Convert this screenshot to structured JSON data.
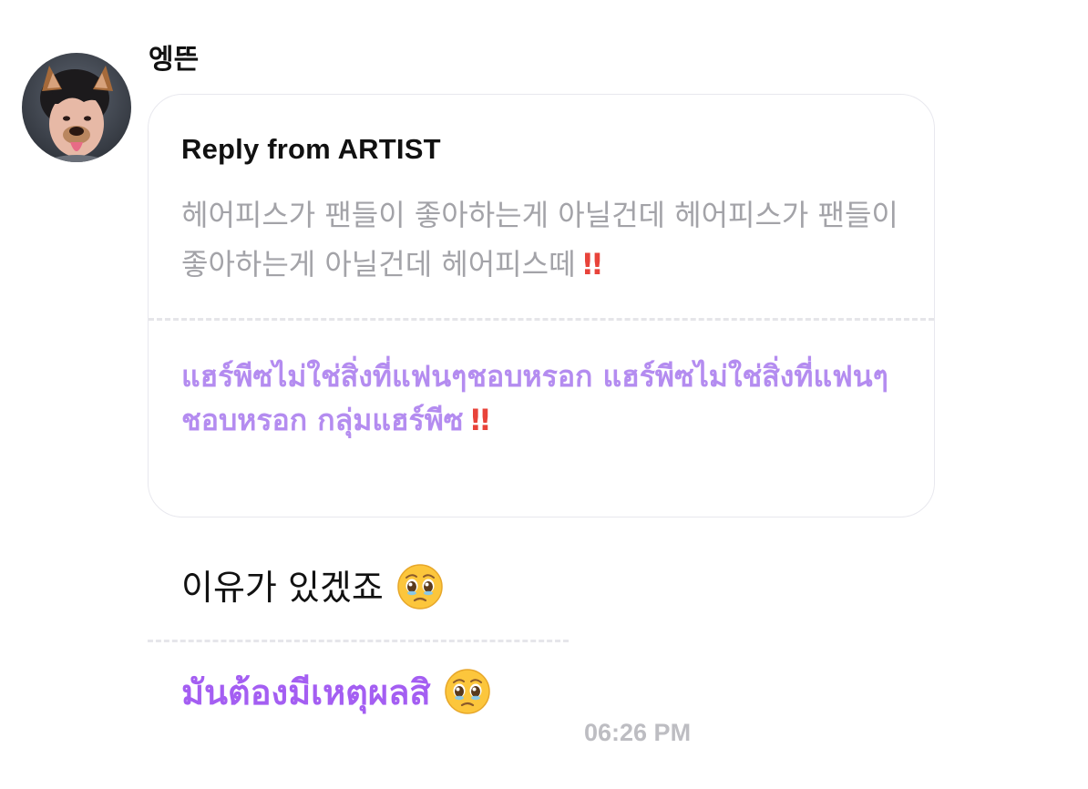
{
  "message": {
    "sender_name": "엥뜬",
    "reply_title": "Reply from ARTIST",
    "reply_original": "헤어피스가 팬들이 좋아하는게 아닐건데 헤어피스가 팬들이 좋아하는게 아닐건데 헤어피스떼",
    "reply_translation": "แฮร์พีซไม่ใช่สิ่งที่แฟนๆชอบหรอก แฮร์พีซไม่ใช่สิ่งที่แฟนๆชอบหรอก กลุ่มแฮร์พีซ",
    "reply_emphasis": "!!",
    "body_original": "이유가 있겠죠",
    "body_translation": "มันต้องมีเหตุผลสิ",
    "timestamp": "06:26 PM"
  },
  "icons": {
    "avatar": "profile-photo-dog-filter",
    "emphasis": "double-exclamation-icon",
    "emoji": "pleading-face-emoji-icon"
  },
  "colors": {
    "original_reply_text": "#a3a3a8",
    "translation_reply_text": "#b48cf0",
    "translation_message_text": "#a45ef2",
    "emphasis": "#e8433a",
    "timestamp": "#bdbdc2",
    "card_border": "#e8e8ee"
  }
}
